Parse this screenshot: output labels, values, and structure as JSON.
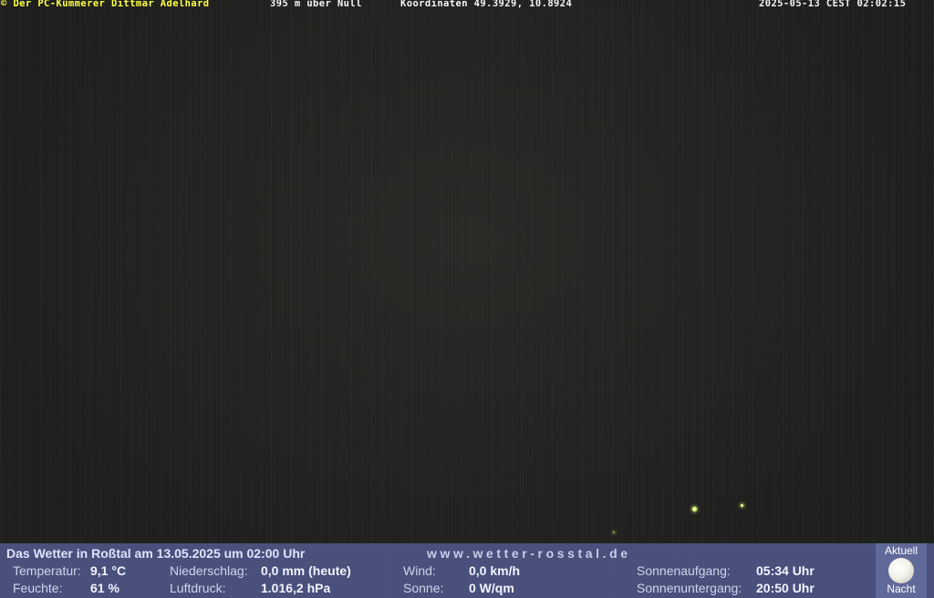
{
  "overlay": {
    "copyright": "© Der PC-Kümmerer Dittmar Adelhard",
    "altitude": "395 m über Null",
    "coordinates": "Koordinaten 49.3929, 10.8924",
    "timestamp": "2025-05-13 CEST 02:02:15"
  },
  "panel": {
    "title": "Das Wetter in Roßtal am 13.05.2025 um 02:00 Uhr",
    "website": "www.wetter-rosstal.de",
    "readings": {
      "temperature": {
        "label": "Temperatur:",
        "value": "9,1 °C"
      },
      "humidity": {
        "label": "Feuchte:",
        "value": "61 %"
      },
      "precipitation": {
        "label": "Niederschlag:",
        "value": "0,0 mm (heute)"
      },
      "pressure": {
        "label": "Luftdruck:",
        "value": "1.016,2 hPa"
      },
      "wind": {
        "label": "Wind:",
        "value": "0,0 km/h"
      },
      "sun": {
        "label": "Sonne:",
        "value": "0 W/qm"
      },
      "sunrise": {
        "label": "Sonnenaufgang:",
        "value": "05:34 Uhr"
      },
      "sunset": {
        "label": "Sonnenuntergang:",
        "value": "20:50 Uhr"
      }
    },
    "moon": {
      "caption_top": "Aktuell",
      "caption_bottom": "Nacht",
      "icon": "full-moon-icon"
    }
  },
  "colors": {
    "overlay_yellow": "#ffff40",
    "overlay_white": "#f4f4f4",
    "panel_background": "#545c94",
    "moon_box": "#606a99"
  }
}
